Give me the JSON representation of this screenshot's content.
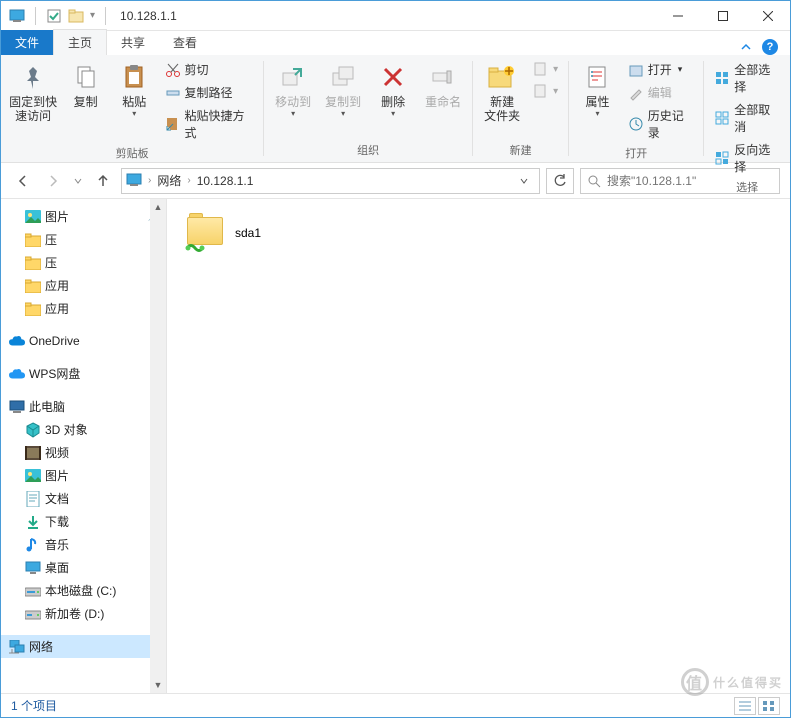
{
  "title": "10.128.1.1",
  "tabs": {
    "file": "文件",
    "home": "主页",
    "share": "共享",
    "view": "查看"
  },
  "ribbon": {
    "pin": "固定到快\n速访问",
    "copy": "复制",
    "paste": "粘贴",
    "cut": "剪切",
    "copy_path": "复制路径",
    "paste_shortcut": "粘贴快捷方式",
    "clipboard_group": "剪贴板",
    "move_to": "移动到",
    "copy_to": "复制到",
    "delete": "删除",
    "rename": "重命名",
    "organize_group": "组织",
    "new_folder": "新建\n文件夹",
    "new_group": "新建",
    "properties": "属性",
    "open": "打开",
    "edit": "编辑",
    "history": "历史记录",
    "open_group": "打开",
    "select_all": "全部选择",
    "select_none": "全部取消",
    "invert": "反向选择",
    "select_group": "选择"
  },
  "breadcrumb": {
    "root": "网络",
    "current": "10.128.1.1"
  },
  "search_placeholder": "搜索\"10.128.1.1\"",
  "sidebar": {
    "pictures": "图片",
    "compress1": "压",
    "compress2": "压",
    "app1": "应用",
    "app2": "应用",
    "onedrive": "OneDrive",
    "wps": "WPS网盘",
    "this_pc": "此电脑",
    "objects3d": "3D 对象",
    "videos": "视频",
    "pictures2": "图片",
    "documents": "文档",
    "downloads": "下载",
    "music": "音乐",
    "desktop": "桌面",
    "disk_c": "本地磁盘 (C:)",
    "disk_d": "新加卷 (D:)",
    "network": "网络"
  },
  "content": {
    "items": [
      {
        "name": "sda1"
      }
    ]
  },
  "status": "1 个项目",
  "watermark": "什么值得买"
}
